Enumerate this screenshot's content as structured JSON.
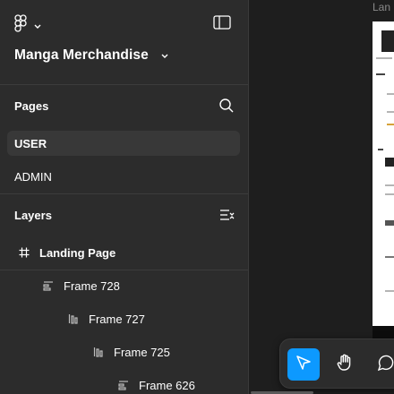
{
  "header": {
    "logo_icon": "figma-logo-icon",
    "file_name": "Manga Merchandise",
    "panel_toggle_icon": "sidebar-toggle-icon"
  },
  "pages": {
    "title": "Pages",
    "items": [
      {
        "label": "USER",
        "selected": true
      },
      {
        "label": "ADMIN",
        "selected": false
      }
    ]
  },
  "layers": {
    "title": "Layers",
    "items": [
      {
        "label": "Landing Page",
        "icon": "frame-hash-icon",
        "depth": 0
      },
      {
        "label": "Frame 728",
        "icon": "horizontal-autolayout-icon",
        "depth": 1
      },
      {
        "label": "Frame 727",
        "icon": "vertical-autolayout-icon",
        "depth": 2
      },
      {
        "label": "Frame 725",
        "icon": "vertical-autolayout-icon",
        "depth": 3
      },
      {
        "label": "Frame 626",
        "icon": "horizontal-autolayout-icon",
        "depth": 4
      }
    ]
  },
  "canvas": {
    "frame_label": "Lan"
  },
  "toolbar": {
    "tools": [
      {
        "icon": "move-cursor-icon",
        "active": true
      },
      {
        "icon": "hand-icon",
        "active": false
      },
      {
        "icon": "comment-icon",
        "active": false
      }
    ]
  },
  "colors": {
    "sidebar_bg": "#2c2c2c",
    "canvas_bg": "#1e1e1e",
    "selected_page_bg": "#383838",
    "accent": "#0d99ff"
  }
}
